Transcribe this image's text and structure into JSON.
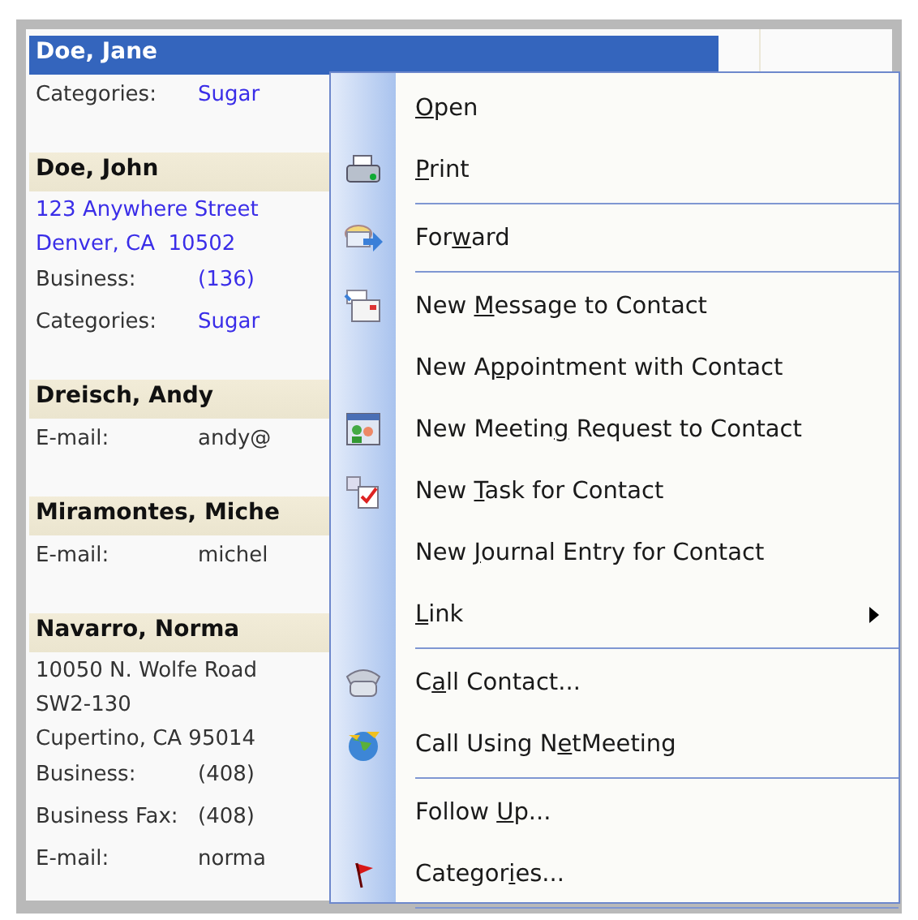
{
  "contacts": [
    {
      "name": "Doe, Jane",
      "selected": true,
      "fields": [
        {
          "label": "Categories:",
          "value": "Sugar",
          "link": true
        }
      ]
    },
    {
      "name": "Doe, John",
      "selected": false,
      "address_link": true,
      "address": [
        "123 Anywhere Street",
        "Denver, CA  10502"
      ],
      "fields": [
        {
          "label": "Business:",
          "value": "(136)",
          "link": true
        },
        {
          "label": "Categories:",
          "value": "Sugar",
          "link": true
        }
      ]
    },
    {
      "name": "Dreisch, Andy",
      "selected": false,
      "fields": [
        {
          "label": "E-mail:",
          "value": "andy@",
          "link": false
        }
      ]
    },
    {
      "name": "Miramontes, Miche",
      "selected": false,
      "fields": [
        {
          "label": "E-mail:",
          "value": "michel",
          "link": false
        }
      ]
    },
    {
      "name": "Navarro, Norma",
      "selected": false,
      "address_link": false,
      "address": [
        "10050 N. Wolfe Road",
        "SW2-130",
        "Cupertino, CA 95014"
      ],
      "fields": [
        {
          "label": "Business:",
          "value": "(408)",
          "link": false
        },
        {
          "label": "Business Fax:",
          "value": "(408)",
          "link": false
        },
        {
          "label": "E-mail:",
          "value": "norma",
          "link": false
        }
      ]
    }
  ],
  "context_menu": {
    "items": [
      {
        "key": "O",
        "after": "pen",
        "separator_after": false,
        "submenu": false
      },
      {
        "key": "P",
        "after": "rint",
        "separator_after": true,
        "submenu": false
      },
      {
        "before": "For",
        "key": "w",
        "after": "ard",
        "separator_after": true,
        "submenu": false
      },
      {
        "before": "New ",
        "key": "M",
        "after": "essage to Contact",
        "separator_after": false,
        "submenu": false
      },
      {
        "before": "New A",
        "key": "p",
        "after": "pointment with Contact",
        "separator_after": false,
        "submenu": false
      },
      {
        "before": "New Meetin",
        "key": "g",
        "after": " Request to Contact",
        "separator_after": false,
        "submenu": false
      },
      {
        "before": "New ",
        "key": "T",
        "after": "ask for Contact",
        "separator_after": false,
        "submenu": false
      },
      {
        "before": "New ",
        "key": "J",
        "after": "ournal Entry for Contact",
        "separator_after": false,
        "submenu": false
      },
      {
        "key": "L",
        "after": "ink",
        "separator_after": true,
        "submenu": true
      },
      {
        "before": "C",
        "key": "a",
        "after": "ll Contact...",
        "separator_after": false,
        "submenu": false
      },
      {
        "before": "Call Using N",
        "key": "e",
        "after": "tMeeting",
        "separator_after": true,
        "submenu": false
      },
      {
        "before": "Follow ",
        "key": "U",
        "after": "p...",
        "separator_after": false,
        "submenu": false
      },
      {
        "before": "Categor",
        "key": "i",
        "after": "es...",
        "separator_after": true,
        "submenu": false
      }
    ]
  }
}
